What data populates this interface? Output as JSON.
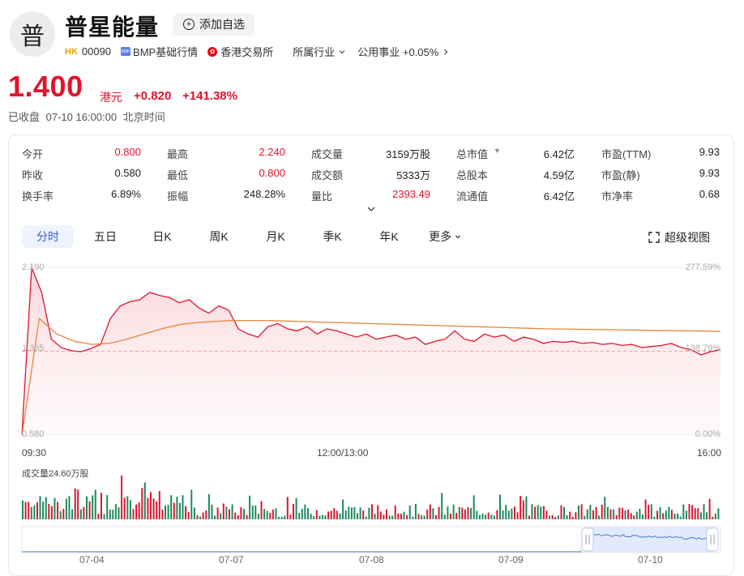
{
  "header": {
    "logo_char": "普",
    "name": "普星能量",
    "watch_label": "添加自选",
    "market_badge": "HK",
    "code": "00090",
    "bmp_label": "BMP基础行情",
    "exchange": "香港交易所",
    "industry_label": "所属行业",
    "sector_label": "公用事业 +0.05%"
  },
  "quote": {
    "price": "1.400",
    "unit": "港元",
    "change": "+0.820",
    "change_pct": "+141.38%",
    "status": "已收盘",
    "time": "07-10 16:00:00",
    "tz": "北京时间"
  },
  "stats": [
    [
      {
        "label": "今开",
        "value": "0.800",
        "color": "red"
      },
      {
        "label": "最高",
        "value": "2.240",
        "color": "red"
      },
      {
        "label": "成交量",
        "value": "3159万股"
      },
      {
        "label": "总市值",
        "value": "6.42亿",
        "has_caret": true
      },
      {
        "label": "市盈(TTM)",
        "value": "9.93"
      }
    ],
    [
      {
        "label": "昨收",
        "value": "0.580"
      },
      {
        "label": "最低",
        "value": "0.800",
        "color": "red"
      },
      {
        "label": "成交额",
        "value": "5333万"
      },
      {
        "label": "总股本",
        "value": "4.59亿"
      },
      {
        "label": "市盈(静)",
        "value": "9.93"
      }
    ],
    [
      {
        "label": "换手率",
        "value": "6.89%"
      },
      {
        "label": "振幅",
        "value": "248.28%"
      },
      {
        "label": "量比",
        "value": "2393.49",
        "color": "red"
      },
      {
        "label": "流通值",
        "value": "6.42亿"
      },
      {
        "label": "市净率",
        "value": "0.68"
      }
    ]
  ],
  "tabs": [
    "分时",
    "五日",
    "日K",
    "周K",
    "月K",
    "季K",
    "年K",
    "更多"
  ],
  "active_tab": "分时",
  "super_view_label": "超级视图",
  "chart_axes": {
    "y_top_left": "2.190",
    "y_mid_left": "1.385",
    "y_bottom_left": "0.580",
    "y_top_right": "277.59%",
    "y_mid_right": "138.79%",
    "y_bottom_right": "0.00%",
    "x_start": "09:30",
    "x_mid": "12:00/13:00",
    "x_end": "16:00"
  },
  "volume_label": "成交量24.60万股",
  "nav_dates": [
    "07-04",
    "07-07",
    "07-08",
    "07-09",
    "07-10"
  ],
  "colors": {
    "up": "#e0142c",
    "down": "#1a8a5c",
    "avg": "#e8833a",
    "accent": "#2b5fd9"
  },
  "chart_data": {
    "type": "line",
    "x": [
      "09:30",
      "12:00/13:00",
      "16:00"
    ],
    "ylim": [
      0.58,
      2.19
    ],
    "series": [
      {
        "values": [
          0.58,
          2.19,
          1.95,
          1.5,
          1.42,
          1.39,
          1.38,
          1.41,
          1.45,
          1.7,
          1.82,
          1.86,
          1.88,
          1.95,
          1.92,
          1.9,
          1.85,
          1.88,
          1.8,
          1.75,
          1.82,
          1.78,
          1.6,
          1.55,
          1.52,
          1.62,
          1.65,
          1.6,
          1.58,
          1.62,
          1.55,
          1.6,
          1.58,
          1.55,
          1.52,
          1.55,
          1.5,
          1.52,
          1.54,
          1.5,
          1.52,
          1.45,
          1.48,
          1.5,
          1.58,
          1.5,
          1.48,
          1.55,
          1.52,
          1.54,
          1.48,
          1.52,
          1.5,
          1.46,
          1.48,
          1.47,
          1.48,
          1.46,
          1.47,
          1.45,
          1.46,
          1.44,
          1.45,
          1.42,
          1.43,
          1.44,
          1.46,
          1.42,
          1.4,
          1.35,
          1.38,
          1.4
        ]
      },
      {
        "values": [
          0.58,
          1.7,
          1.55,
          1.48,
          1.45,
          1.46,
          1.5,
          1.55,
          1.6,
          1.64,
          1.66,
          1.67,
          1.68,
          1.68,
          1.68,
          1.675,
          1.67,
          1.665,
          1.66,
          1.655,
          1.65,
          1.645,
          1.64,
          1.635,
          1.63,
          1.625,
          1.62,
          1.615,
          1.61,
          1.605,
          1.6,
          1.598,
          1.595,
          1.592,
          1.59,
          1.588,
          1.585,
          1.582,
          1.58,
          1.578,
          1.575
        ]
      }
    ]
  }
}
